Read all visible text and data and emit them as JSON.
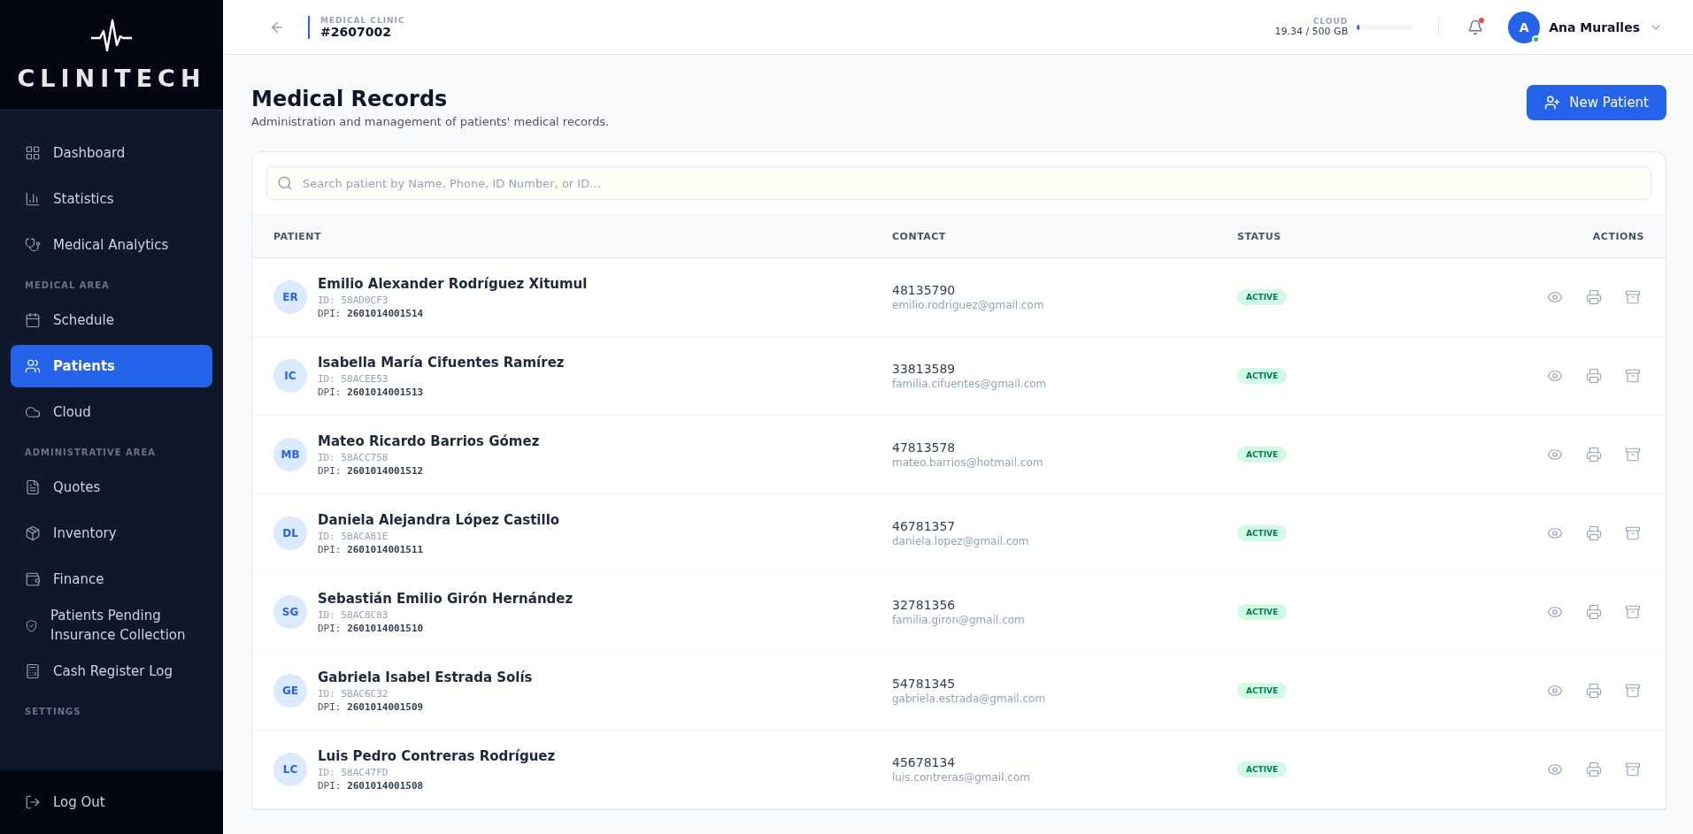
{
  "sidebar": {
    "logo": "CLINITECH",
    "nav": [
      {
        "kind": "item",
        "label": "Dashboard",
        "selected": false
      },
      {
        "kind": "item",
        "label": "Statistics",
        "selected": false
      },
      {
        "kind": "item",
        "label": "Medical Analytics",
        "selected": false
      },
      {
        "kind": "section",
        "label": "MEDICAL AREA"
      },
      {
        "kind": "item",
        "label": "Schedule",
        "selected": false
      },
      {
        "kind": "item",
        "label": "Patients",
        "selected": true
      },
      {
        "kind": "item",
        "label": "Cloud",
        "selected": false
      },
      {
        "kind": "section",
        "label": "ADMINISTRATIVE AREA"
      },
      {
        "kind": "item",
        "label": "Quotes",
        "selected": false
      },
      {
        "kind": "item",
        "label": "Inventory",
        "selected": false
      },
      {
        "kind": "item",
        "label": "Finance",
        "selected": false
      },
      {
        "kind": "item",
        "label": "Patients Pending Insurance Collection",
        "selected": false
      },
      {
        "kind": "item",
        "label": "Cash Register Log",
        "selected": false
      },
      {
        "kind": "section",
        "label": "SETTINGS"
      }
    ],
    "logout": "Log Out"
  },
  "header": {
    "clinic_label": "MEDICAL CLINIC",
    "clinic_id": "#2607002",
    "storage": {
      "label": "CLOUD",
      "reading": "19.34 / 500 GB",
      "level": 0.04
    },
    "has_unread": true,
    "user": {
      "initial": "A",
      "name": "Ana Muralles",
      "online": true
    }
  },
  "page": {
    "title": "Medical Records",
    "subtitle": "Administration and management of patients' medical records.",
    "new_button": "New Patient"
  },
  "search": {
    "placeholder": "Search patient by Name, Phone, ID Number, or ID..."
  },
  "table": {
    "columns": [
      "PATIENT",
      "CONTACT",
      "STATUS",
      "ACTIONS"
    ],
    "rows": [
      {
        "initials": "ER",
        "name": "Emilio Alexander Rodríguez Xitumul",
        "id": "ID: 58AD0CF3",
        "dpi_label": "DPI:",
        "dpi": "2601014001514",
        "phone": "48135790",
        "email": "emilio.rodriguez@gmail.com",
        "status": "ACTIVE",
        "kind": "active"
      },
      {
        "initials": "IC",
        "name": "Isabella María Cifuentes Ramírez",
        "id": "ID: 58ACEE53",
        "dpi_label": "DPI:",
        "dpi": "2601014001513",
        "phone": "33813589",
        "email": "familia.cifuentes@gmail.com",
        "status": "ACTIVE",
        "kind": "active"
      },
      {
        "initials": "MB",
        "name": "Mateo Ricardo Barrios Gómez",
        "id": "ID: 58ACC758",
        "dpi_label": "DPI:",
        "dpi": "2601014001512",
        "phone": "47813578",
        "email": "mateo.barrios@hotmail.com",
        "status": "ACTIVE",
        "kind": "active"
      },
      {
        "initials": "DL",
        "name": "Daniela Alejandra López Castillo",
        "id": "ID: 58ACA81E",
        "dpi_label": "DPI:",
        "dpi": "2601014001511",
        "phone": "46781357",
        "email": "daniela.lopez@gmail.com",
        "status": "ACTIVE",
        "kind": "active"
      },
      {
        "initials": "SG",
        "name": "Sebastián Emilio Girón Hernández",
        "id": "ID: 58AC8C83",
        "dpi_label": "DPI:",
        "dpi": "2601014001510",
        "phone": "32781356",
        "email": "familia.giron@gmail.com",
        "status": "ACTIVE",
        "kind": "active"
      },
      {
        "initials": "GE",
        "name": "Gabriela Isabel Estrada Solís",
        "id": "ID: 58AC6C32",
        "dpi_label": "DPI:",
        "dpi": "2601014001509",
        "phone": "54781345",
        "email": "gabriela.estrada@gmail.com",
        "status": "ACTIVE",
        "kind": "active"
      },
      {
        "initials": "LC",
        "name": "Luis Pedro Contreras Rodríguez",
        "id": "ID: 58AC47FD",
        "dpi_label": "DPI:",
        "dpi": "2601014001508",
        "phone": "45678134",
        "email": "luis.contreras@gmail.com",
        "status": "ACTIVE",
        "kind": "active"
      }
    ]
  }
}
